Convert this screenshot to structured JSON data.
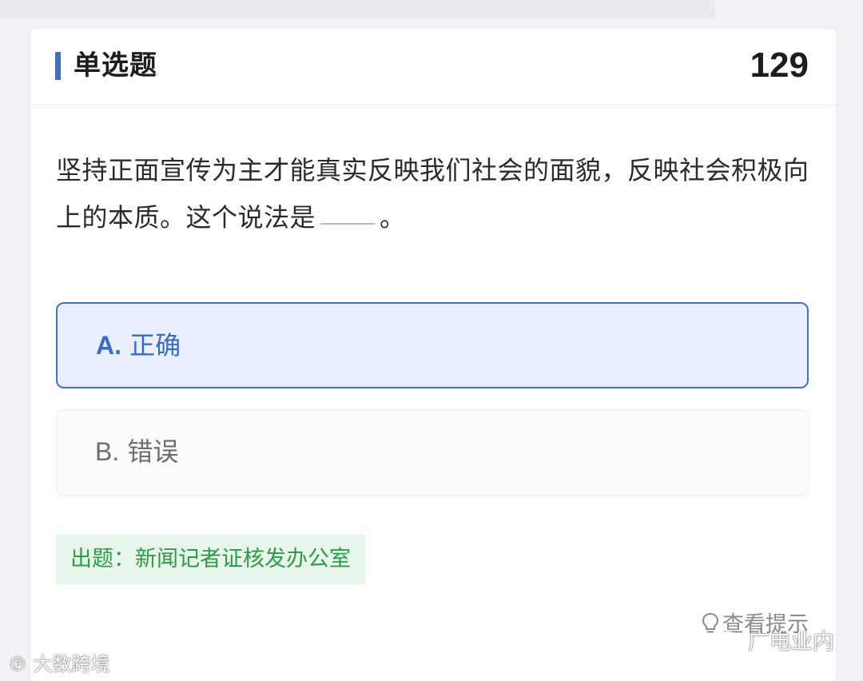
{
  "header": {
    "question_type": "单选题",
    "question_number": "129"
  },
  "question": {
    "text_before_blank": "坚持正面宣传为主才能真实反映我们社会的面貌，反映社会积极向上的本质。这个说法是",
    "text_after_blank": "。"
  },
  "options": [
    {
      "letter": "A.",
      "label": "正确",
      "selected": true
    },
    {
      "letter": "B.",
      "label": "错误",
      "selected": false
    }
  ],
  "source": {
    "text": "出题：新闻记者证核发办公室"
  },
  "hint": {
    "label": "查看提示",
    "icon": "lightbulb-icon"
  },
  "watermarks": {
    "left": "大数跨境",
    "right": "广电业内"
  },
  "colors": {
    "accent": "#3d6fc6",
    "selected_bg": "#e9effc",
    "source_bg": "#e8f5ea",
    "source_text": "#2f9a49"
  }
}
